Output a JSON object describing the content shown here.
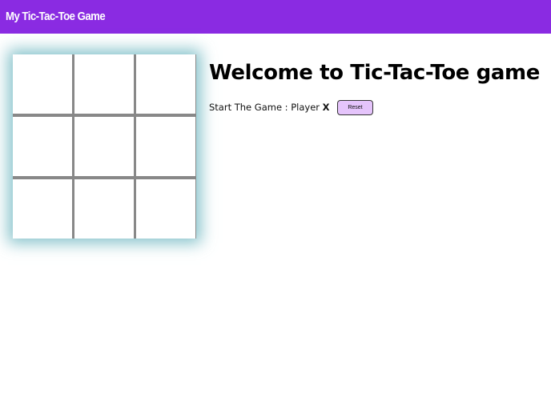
{
  "header": {
    "title": "My Tic-Tac-Toe Game"
  },
  "main": {
    "heading": "Welcome to Tic-Tac-Toe game",
    "status_prefix": "Start The Game : Player",
    "current_player": "X",
    "reset_label": "Reset"
  },
  "board": {
    "cells": [
      "",
      "",
      "",
      "",
      "",
      "",
      "",
      "",
      ""
    ]
  },
  "colors": {
    "navbar": "#8a2be2",
    "reset_button": "#e5c4fb",
    "board_glow": "#5fafb9",
    "grid_lines": "#888888"
  }
}
